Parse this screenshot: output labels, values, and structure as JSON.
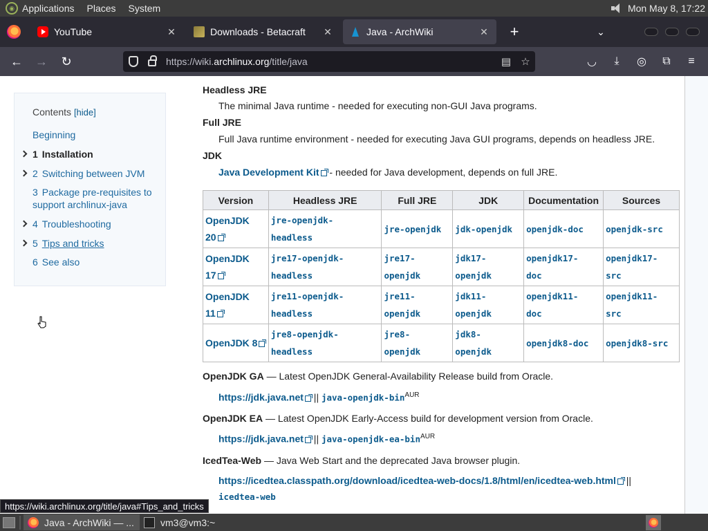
{
  "desktop": {
    "menus": [
      "Applications",
      "Places",
      "System"
    ],
    "clock": "Mon May  8, 17:22"
  },
  "browser": {
    "tabs": [
      {
        "label": "YouTube",
        "favicon": "youtube-icon"
      },
      {
        "label": "Downloads - Betacraft",
        "favicon": "betacraft-icon"
      },
      {
        "label": "Java - ArchWiki",
        "favicon": "archwiki-icon"
      }
    ],
    "url_prefix": "https://wiki.",
    "url_domain": "archlinux.org",
    "url_path": "/title/java",
    "status_url": "https://wiki.archlinux.org/title/java#Tips_and_tricks"
  },
  "toc": {
    "title": "Contents",
    "hide_label": "[hide]",
    "items": [
      {
        "num": "",
        "label": "Beginning"
      },
      {
        "num": "1",
        "label": "Installation"
      },
      {
        "num": "2",
        "label": "Switching between JVM"
      },
      {
        "num": "3",
        "label": "Package pre-requisites to"
      },
      {
        "num": "",
        "label": "support archlinux-java"
      },
      {
        "num": "4",
        "label": "Troubleshooting"
      },
      {
        "num": "5",
        "label": "Tips and tricks"
      },
      {
        "num": "6",
        "label": "See also"
      }
    ]
  },
  "content": {
    "defs": [
      {
        "term": "Headless JRE",
        "desc": "The minimal Java runtime - needed for executing non-GUI Java programs."
      },
      {
        "term": "Full JRE",
        "desc": "Full Java runtime environment - needed for executing Java GUI programs, depends on headless JRE."
      },
      {
        "term": "JDK",
        "link": "Java Development Kit",
        "desc": " - needed for Java development, depends on full JRE."
      }
    ],
    "table_headers": [
      "Version",
      "Headless JRE",
      "Full JRE",
      "JDK",
      "Documentation",
      "Sources"
    ],
    "rows": [
      {
        "version_a": "OpenJDK",
        "version_b": "20",
        "headless_a": "jre-openjdk-",
        "headless_b": "headless",
        "full_a": "jre-openjdk",
        "full_b": "",
        "jdk_a": "jdk-openjdk",
        "jdk_b": "",
        "doc_a": "openjdk-doc",
        "doc_b": "",
        "src_a": "openjdk-src",
        "src_b": ""
      },
      {
        "version_a": "OpenJDK",
        "version_b": "17",
        "headless_a": "jre17-openjdk-",
        "headless_b": "headless",
        "full_a": "jre17-",
        "full_b": "openjdk",
        "jdk_a": "jdk17-",
        "jdk_b": "openjdk",
        "doc_a": "openjdk17-",
        "doc_b": "doc",
        "src_a": "openjdk17-",
        "src_b": "src"
      },
      {
        "version_a": "OpenJDK",
        "version_b": "11",
        "headless_a": "jre11-openjdk-",
        "headless_b": "headless",
        "full_a": "jre11-",
        "full_b": "openjdk",
        "jdk_a": "jdk11-",
        "jdk_b": "openjdk",
        "doc_a": "openjdk11-",
        "doc_b": "doc",
        "src_a": "openjdk11-",
        "src_b": "src"
      },
      {
        "version_a": "OpenJDK 8",
        "version_b": "",
        "headless_a": "jre8-openjdk-",
        "headless_b": "headless",
        "full_a": "jre8-",
        "full_b": "openjdk",
        "jdk_a": "jdk8-",
        "jdk_b": "openjdk",
        "doc_a": "openjdk8-doc",
        "doc_b": "",
        "src_a": "openjdk8-src",
        "src_b": ""
      }
    ],
    "extras": [
      {
        "term": "OpenJDK GA",
        "desc": " — Latest OpenJDK General-Availability Release build from Oracle.",
        "link": "https://jdk.java.net",
        "sep": " || ",
        "pkg": "java-openjdk-bin",
        "sup": "AUR"
      },
      {
        "term": "OpenJDK EA",
        "desc": " — Latest OpenJDK Early-Access build for development version from Oracle.",
        "link": "https://jdk.java.net",
        "sep": " || ",
        "pkg": "java-openjdk-ea-bin",
        "sup": "AUR"
      },
      {
        "term": "IcedTea-Web",
        "desc": " — Java Web Start and the deprecated Java browser plugin.",
        "link": "https://icedtea.classpath.org/download/icedtea-web-docs/1.8/html/en/icedtea-web.html",
        "sep": " ||",
        "pkg": "icedtea-web",
        "sup": ""
      }
    ]
  },
  "taskbar": {
    "items": [
      "Java - ArchWiki — ...",
      "vm3@vm3:~"
    ]
  }
}
